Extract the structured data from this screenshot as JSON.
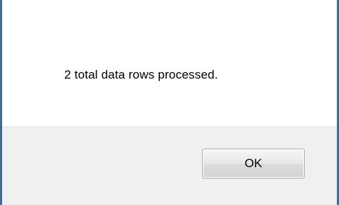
{
  "dialog": {
    "message": "2 total data rows processed.",
    "ok_label": "OK"
  },
  "colors": {
    "content_background": "#ffffff",
    "footer_background": "#f0f0f0",
    "frame_border": "#4a6a8c"
  }
}
